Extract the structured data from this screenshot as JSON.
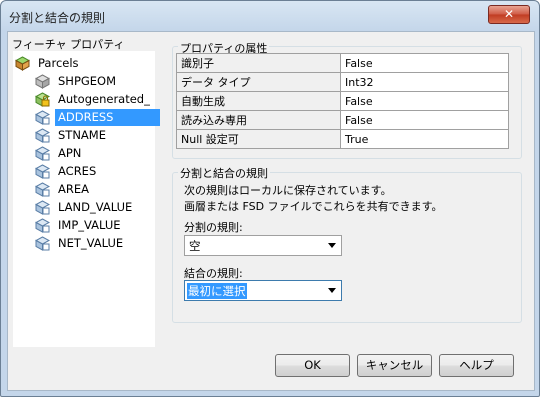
{
  "window": {
    "title": "分割と結合の規則",
    "close_label": "✕"
  },
  "left": {
    "label": "フィーチャ プロパティ",
    "root": "Parcels",
    "fields": [
      "SHPGEOM",
      "Autogenerated_",
      "ADDRESS",
      "STNAME",
      "APN",
      "ACRES",
      "AREA",
      "LAND_VALUE",
      "IMP_VALUE",
      "NET_VALUE"
    ],
    "selected": "ADDRESS"
  },
  "properties": {
    "label": "プロパティの属性",
    "rows": [
      {
        "key": "識別子",
        "value": "False"
      },
      {
        "key": "データ タイプ",
        "value": "Int32"
      },
      {
        "key": "自動生成",
        "value": "False"
      },
      {
        "key": "読み込み専用",
        "value": "False"
      },
      {
        "key": "Null 設定可",
        "value": "True"
      }
    ]
  },
  "rules": {
    "label": "分割と結合の規則",
    "desc1": "次の規則はローカルに保存されています。",
    "desc2": "画層または FSD ファイルでこれらを共有できます。",
    "split_label": "分割の規則:",
    "split_value": "空",
    "merge_label": "結合の規則:",
    "merge_value": "最初に選択"
  },
  "buttons": {
    "ok": "OK",
    "cancel": "キャンセル",
    "help": "ヘルプ"
  }
}
